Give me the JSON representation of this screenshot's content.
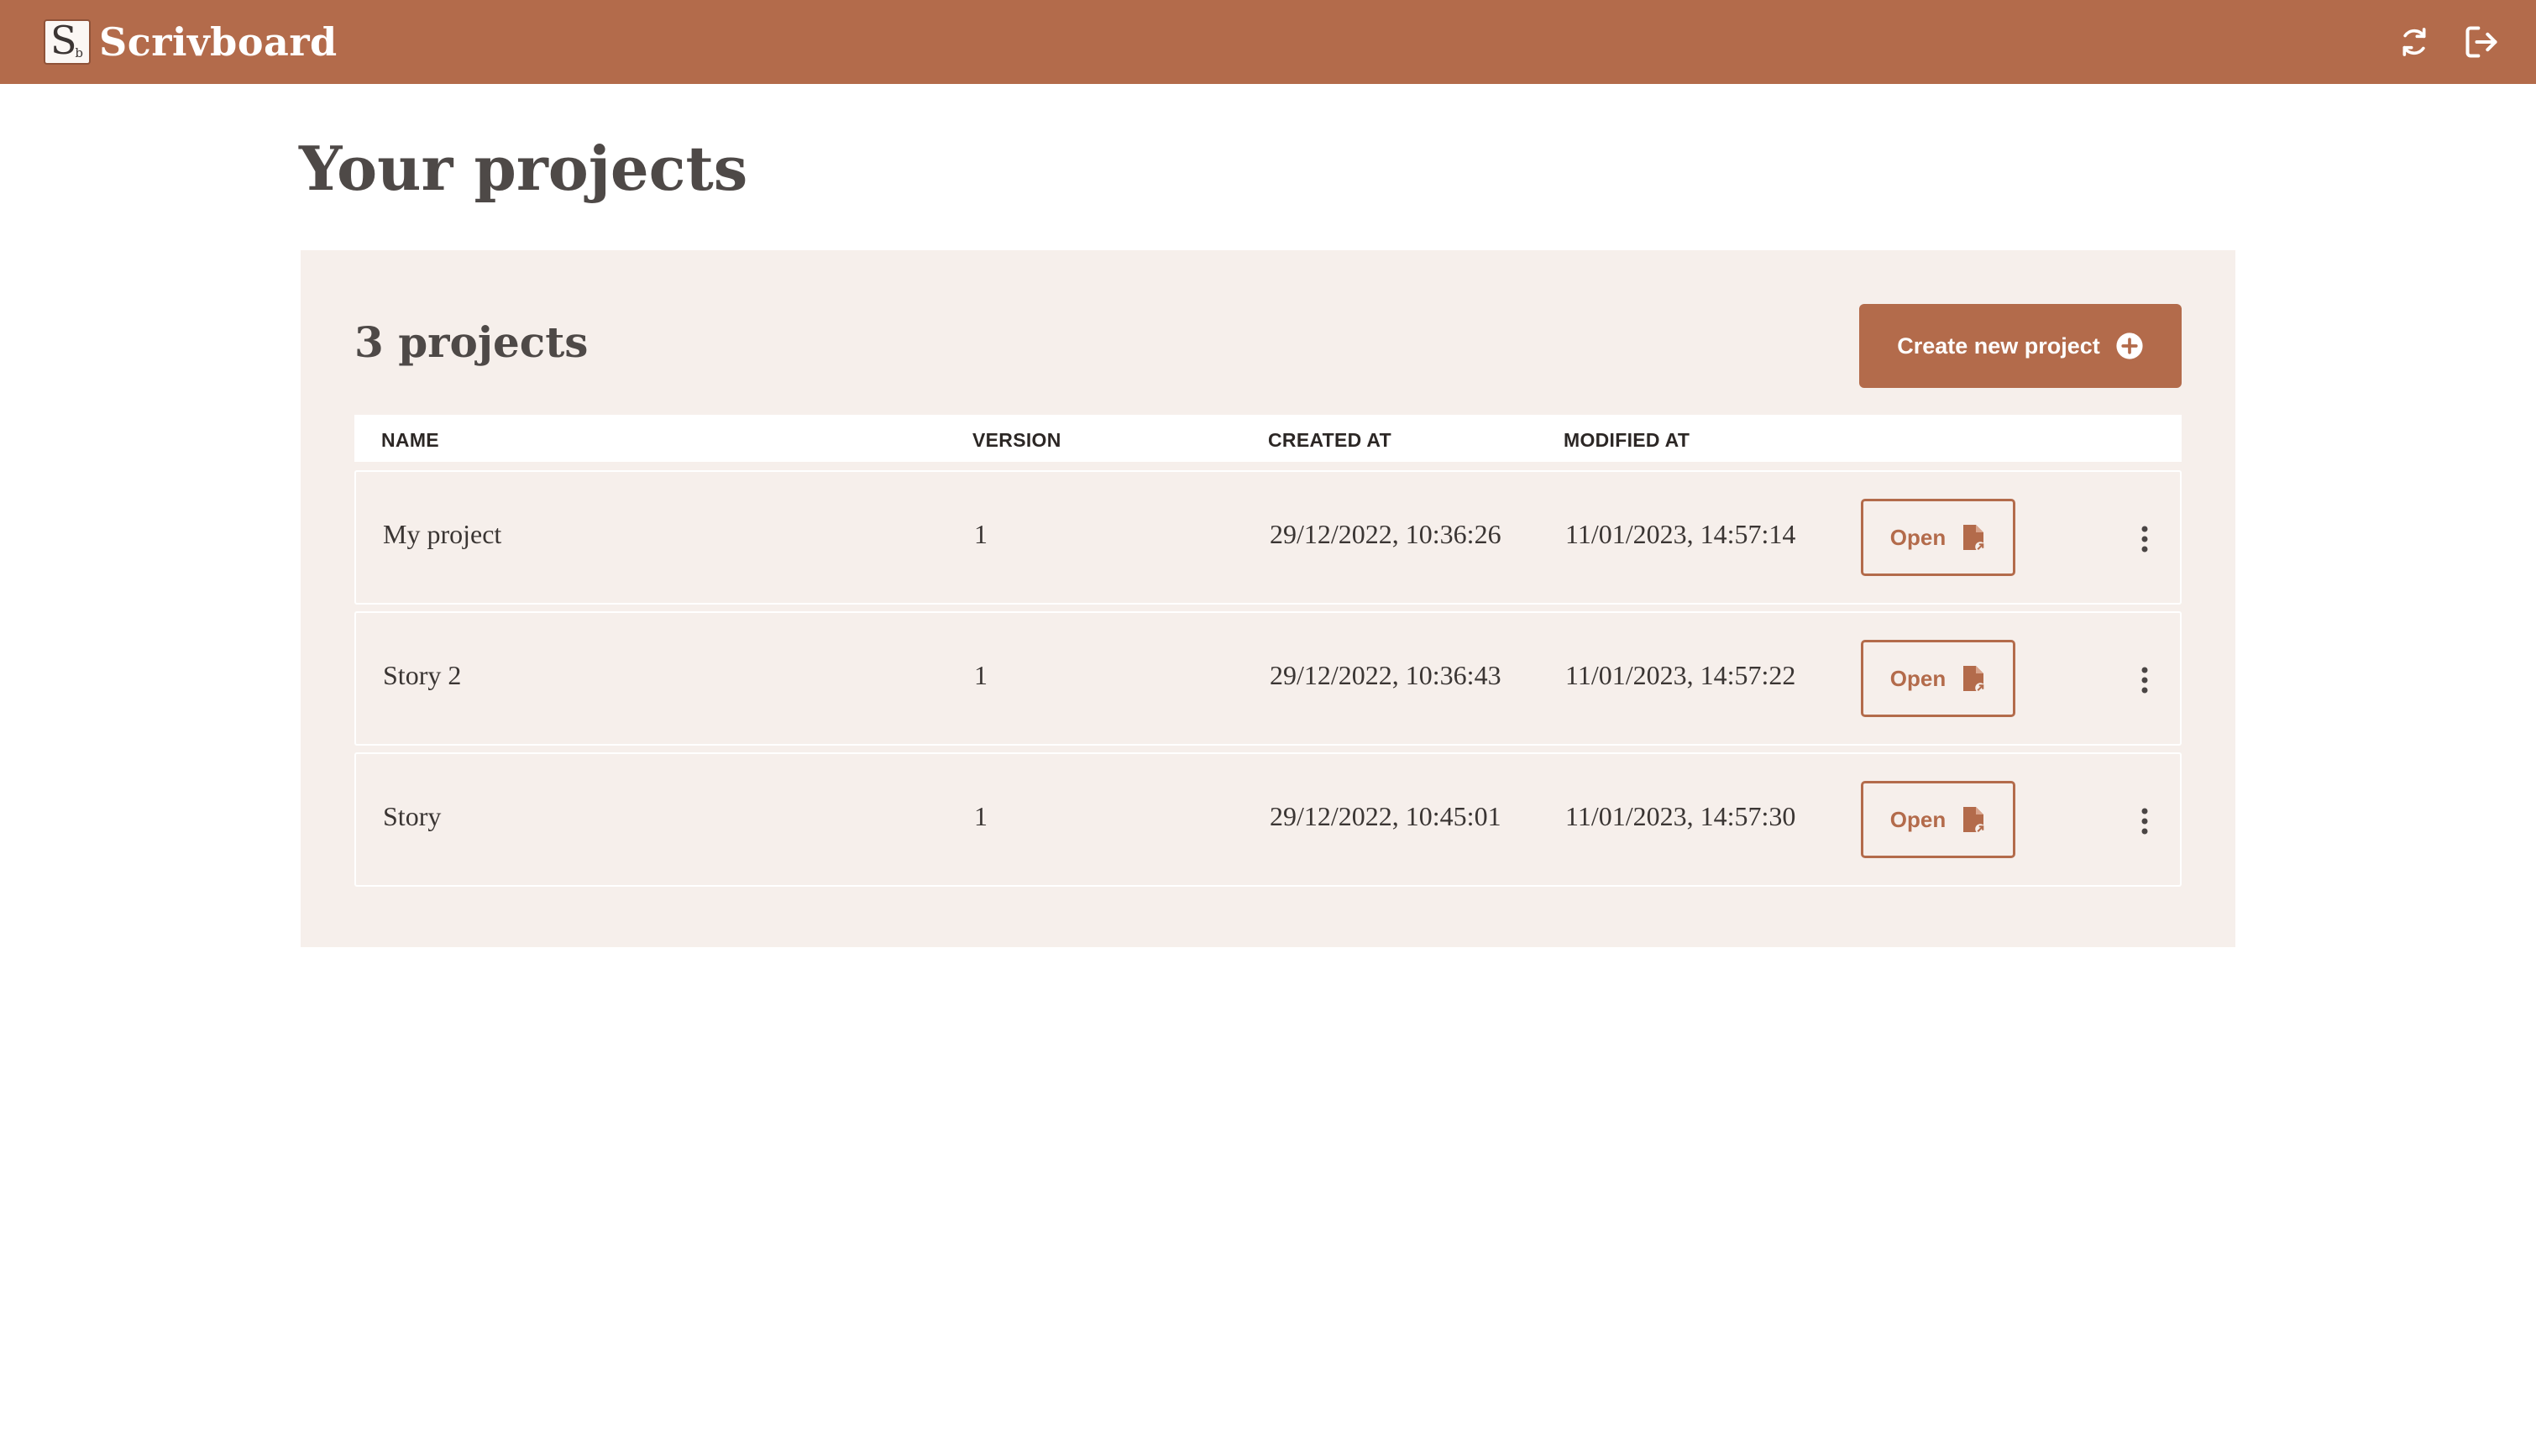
{
  "app": {
    "name": "Scrivboard",
    "logo_letter": "S",
    "logo_small_letter": "b"
  },
  "header": {
    "refresh_icon": "refresh-icon",
    "logout_icon": "logout-icon"
  },
  "page": {
    "title": "Your projects"
  },
  "projects_panel": {
    "count_label": "3 projects",
    "create_button_label": "Create new project",
    "columns": [
      "NAME",
      "VERSION",
      "CREATED AT",
      "MODIFIED AT"
    ],
    "rows": [
      {
        "name": "My project",
        "version": "1",
        "created_at": "29/12/2022, 10:36:26",
        "modified_at": "11/01/2023, 14:57:14",
        "open_label": "Open"
      },
      {
        "name": "Story 2",
        "version": "1",
        "created_at": "29/12/2022, 10:36:43",
        "modified_at": "11/01/2023, 14:57:22",
        "open_label": "Open"
      },
      {
        "name": "Story",
        "version": "1",
        "created_at": "29/12/2022, 10:45:01",
        "modified_at": "11/01/2023, 14:57:30",
        "open_label": "Open"
      }
    ]
  },
  "colors": {
    "brand": "#b36b4b",
    "panel_background": "#f6efeb",
    "heading_text": "#4e4947"
  }
}
